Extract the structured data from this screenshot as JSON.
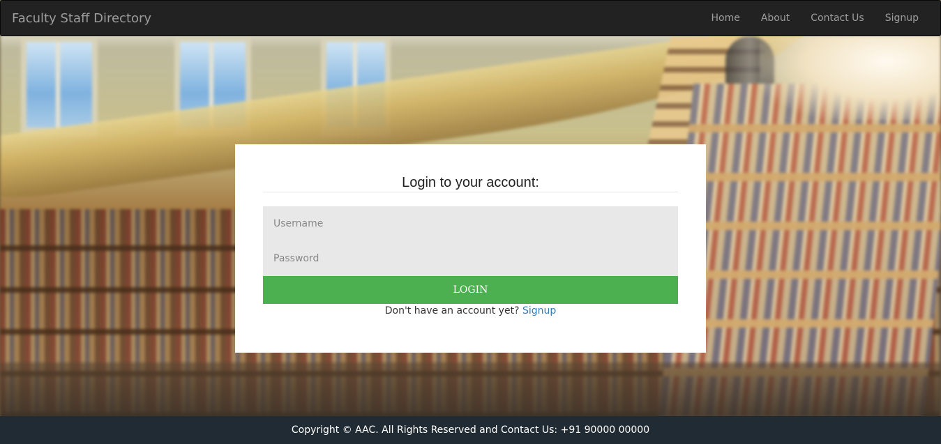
{
  "navbar": {
    "brand": "Faculty Staff Directory",
    "links": [
      "Home",
      "About",
      "Contact Us",
      "Signup"
    ]
  },
  "login": {
    "title": "Login to your account:",
    "username_placeholder": "Username",
    "password_placeholder": "Password",
    "button_label": "LOGIN",
    "no_account_text": "Don't have an account yet?",
    "signup_link": "Signup"
  },
  "footer": {
    "text": "Copyright © AAC. All Rights Reserved and Contact Us: +91 90000 00000"
  },
  "colors": {
    "navbar_bg": "#222222",
    "login_button": "#4caf50",
    "link": "#337ab7",
    "footer_bg": "#212b33",
    "input_bg": "#e8e8e8"
  }
}
